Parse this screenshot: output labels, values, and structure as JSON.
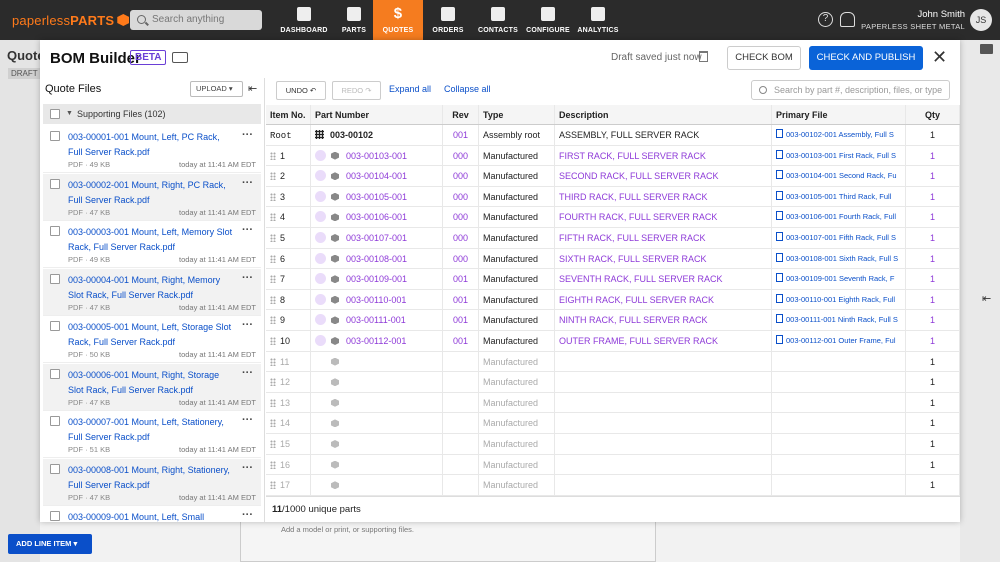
{
  "app": {
    "logo_a": "paperless",
    "logo_b": "PARTS",
    "search_placeholder": "Search anything"
  },
  "nav": [
    {
      "label": "DASHBOARD",
      "icon": "dashboard-icon"
    },
    {
      "label": "PARTS",
      "icon": "parts-icon"
    },
    {
      "label": "QUOTES",
      "icon": "dollar-icon",
      "glyph": "$"
    },
    {
      "label": "ORDERS",
      "icon": "orders-icon"
    },
    {
      "label": "CONTACTS",
      "icon": "contacts-icon"
    },
    {
      "label": "CONFIGURE",
      "icon": "gears-icon"
    },
    {
      "label": "ANALYTICS",
      "icon": "analytics-icon"
    }
  ],
  "user": {
    "name": "John Smith",
    "org": "PAPERLESS SHEET METAL",
    "initials": "JS"
  },
  "background": {
    "quote_title": "Quote",
    "draft": "DRAFT",
    "add_line_item": "ADD LINE ITEM",
    "hint": "Add a model or print, or supporting files."
  },
  "modal": {
    "title": "BOM Builder",
    "beta": "BETA",
    "saved": "Draft saved just now",
    "check_bom": "CHECK BOM",
    "check_publish": "CHECK AND PUBLISH",
    "close": "✕"
  },
  "quote_files": {
    "title": "Quote Files",
    "upload": "UPLOAD",
    "supporting": "Supporting Files (102)",
    "files": [
      {
        "name": "003-00001-001 Mount, Left, PC Rack, Full Server Rack.pdf",
        "meta": "PDF · 49 KB",
        "time": "today at 11:41 AM EDT"
      },
      {
        "name": "003-00002-001 Mount, Right, PC Rack, Full Server Rack.pdf",
        "meta": "PDF · 47 KB",
        "time": "today at 11:41 AM EDT"
      },
      {
        "name": "003-00003-001 Mount, Left, Memory Slot Rack, Full Server Rack.pdf",
        "meta": "PDF · 49 KB",
        "time": "today at 11:41 AM EDT"
      },
      {
        "name": "003-00004-001 Mount, Right, Memory Slot Rack, Full Server Rack.pdf",
        "meta": "PDF · 47 KB",
        "time": "today at 11:41 AM EDT"
      },
      {
        "name": "003-00005-001 Mount, Left, Storage Slot Rack, Full Server Rack.pdf",
        "meta": "PDF · 50 KB",
        "time": "today at 11:41 AM EDT"
      },
      {
        "name": "003-00006-001 Mount, Right, Storage Slot Rack, Full Server Rack.pdf",
        "meta": "PDF · 47 KB",
        "time": "today at 11:41 AM EDT"
      },
      {
        "name": "003-00007-001 Mount, Left, Stationery, Full Server Rack.pdf",
        "meta": "PDF · 51 KB",
        "time": "today at 11:41 AM EDT"
      },
      {
        "name": "003-00008-001 Mount, Right, Stationery, Full Server Rack.pdf",
        "meta": "PDF · 47 KB",
        "time": "today at 11:41 AM EDT"
      },
      {
        "name": "003-00009-001 Mount, Left, Small",
        "meta": "",
        "time": ""
      }
    ]
  },
  "toolbar": {
    "undo": "UNDO ↶",
    "redo": "REDO ↷",
    "expand": "Expand all",
    "collapse": "Collapse all",
    "search_placeholder": "Search by part #, description, files, or type"
  },
  "table": {
    "headers": [
      "Item No.",
      "Part Number",
      "Rev",
      "Type",
      "Description",
      "Primary File",
      "Qty"
    ],
    "root": {
      "item": "Root",
      "part": "003-00102",
      "rev": "001",
      "type": "Assembly root",
      "desc": "ASSEMBLY, FULL SERVER RACK",
      "file": "003-00102-001 Assembly, Full S",
      "qty": "1"
    },
    "rows": [
      {
        "item": "1",
        "part": "003-00103-001",
        "rev": "000",
        "type": "Manufactured",
        "desc": "FIRST RACK, FULL SERVER RACK",
        "file": "003-00103-001 First Rack, Full S",
        "qty": "1"
      },
      {
        "item": "2",
        "part": "003-00104-001",
        "rev": "000",
        "type": "Manufactured",
        "desc": "SECOND RACK, FULL SERVER RACK",
        "file": "003-00104-001 Second Rack, Fu",
        "qty": "1"
      },
      {
        "item": "3",
        "part": "003-00105-001",
        "rev": "000",
        "type": "Manufactured",
        "desc": "THIRD RACK, FULL SERVER RACK",
        "file": "003-00105-001 Third Rack, Full",
        "qty": "1"
      },
      {
        "item": "4",
        "part": "003-00106-001",
        "rev": "000",
        "type": "Manufactured",
        "desc": "FOURTH RACK, FULL SERVER RACK",
        "file": "003-00106-001 Fourth Rack, Full",
        "qty": "1"
      },
      {
        "item": "5",
        "part": "003-00107-001",
        "rev": "000",
        "type": "Manufactured",
        "desc": "FIFTH RACK, FULL SERVER RACK",
        "file": "003-00107-001 Fifth Rack, Full S",
        "qty": "1"
      },
      {
        "item": "6",
        "part": "003-00108-001",
        "rev": "000",
        "type": "Manufactured",
        "desc": "SIXTH RACK, FULL SERVER RACK",
        "file": "003-00108-001 Sixth Rack, Full S",
        "qty": "1"
      },
      {
        "item": "7",
        "part": "003-00109-001",
        "rev": "001",
        "type": "Manufactured",
        "desc": "SEVENTH RACK, FULL SERVER RACK",
        "file": "003-00109-001 Seventh Rack, F",
        "qty": "1"
      },
      {
        "item": "8",
        "part": "003-00110-001",
        "rev": "001",
        "type": "Manufactured",
        "desc": "EIGHTH RACK, FULL SERVER RACK",
        "file": "003-00110-001 Eighth Rack, Full",
        "qty": "1"
      },
      {
        "item": "9",
        "part": "003-00111-001",
        "rev": "001",
        "type": "Manufactured",
        "desc": "NINTH RACK, FULL SERVER RACK",
        "file": "003-00111-001 Ninth Rack, Full S",
        "qty": "1"
      },
      {
        "item": "10",
        "part": "003-00112-001",
        "rev": "001",
        "type": "Manufactured",
        "desc": "OUTER FRAME, FULL SERVER RACK",
        "file": "003-00112-001 Outer Frame, Ful",
        "qty": "1"
      }
    ],
    "empty_rows": [
      {
        "item": "11",
        "type": "Manufactured",
        "qty": "1"
      },
      {
        "item": "12",
        "type": "Manufactured",
        "qty": "1"
      },
      {
        "item": "13",
        "type": "Manufactured",
        "qty": "1"
      },
      {
        "item": "14",
        "type": "Manufactured",
        "qty": "1"
      },
      {
        "item": "15",
        "type": "Manufactured",
        "qty": "1"
      },
      {
        "item": "16",
        "type": "Manufactured",
        "qty": "1"
      },
      {
        "item": "17",
        "type": "Manufactured",
        "qty": "1"
      }
    ],
    "footer_count": "11",
    "footer_rest": "/1000 unique parts"
  }
}
